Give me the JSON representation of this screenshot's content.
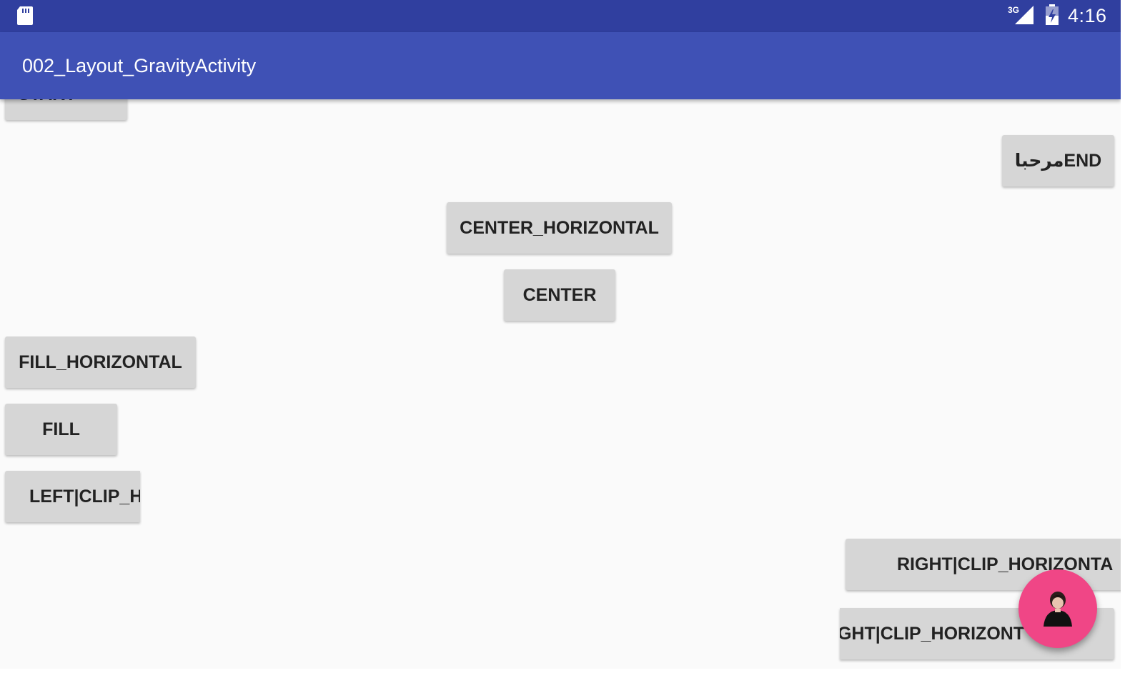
{
  "status_bar": {
    "network_label": "3G",
    "time": "4:16",
    "icons": [
      "sd-card-icon",
      "cell-signal-icon",
      "battery-charging-icon"
    ]
  },
  "app_bar": {
    "title": "002_Layout_GravityActivity"
  },
  "buttons": {
    "start_partial": "START",
    "end": "مرحباEND",
    "center_horizontal": "CENTER_HORIZONTAL",
    "center": "CENTER",
    "fill_horizontal": "FILL_HORIZONTAL",
    "fill": "FILL",
    "left_clip_horizontal": "LEFT|CLIP_H",
    "right_clip_horizontal": "RIGHT|CLIP_HORIZONTA",
    "clip_horizontal": "IGHT|CLIP_HORIZONT"
  },
  "fab": {
    "icon": "person-avatar-icon"
  },
  "colors": {
    "status_bar": "#303f9f",
    "app_bar": "#3f51b5",
    "background": "#fafafa",
    "button": "#d6d6d6",
    "fab": "#f04686"
  }
}
